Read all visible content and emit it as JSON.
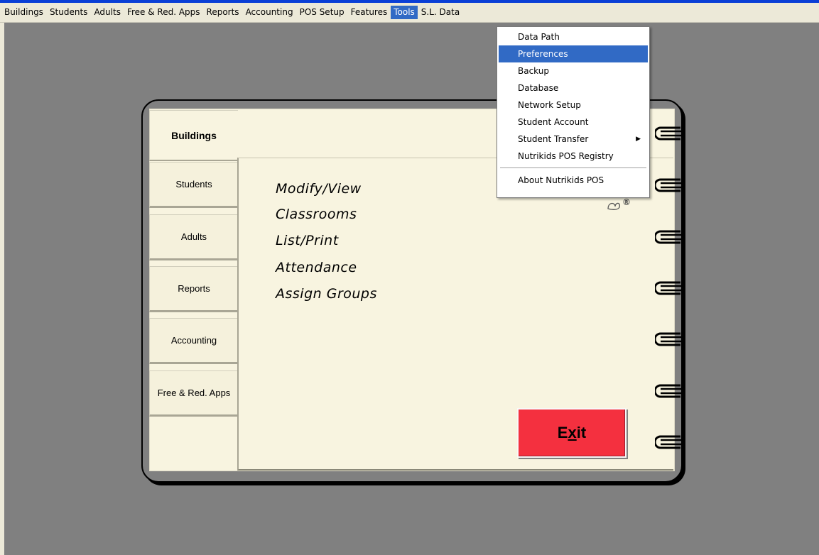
{
  "menubar": {
    "items": [
      {
        "label": "Buildings"
      },
      {
        "label": "Students"
      },
      {
        "label": "Adults"
      },
      {
        "label": "Free & Red. Apps"
      },
      {
        "label": "Reports"
      },
      {
        "label": "Accounting"
      },
      {
        "label": "POS Setup"
      },
      {
        "label": "Features"
      },
      {
        "label": "Tools"
      },
      {
        "label": "S.L. Data"
      }
    ],
    "active": "Tools"
  },
  "tools_menu": {
    "items": [
      {
        "label": "Data Path"
      },
      {
        "label": "Preferences"
      },
      {
        "label": "Backup"
      },
      {
        "label": "Database"
      },
      {
        "label": "Network Setup"
      },
      {
        "label": "Student Account"
      },
      {
        "label": "Student Transfer"
      },
      {
        "label": "Nutrikids POS Registry"
      },
      {
        "label": "About Nutrikids POS"
      }
    ],
    "highlighted": "Preferences"
  },
  "tabs": [
    {
      "label": "Buildings"
    },
    {
      "label": "Students"
    },
    {
      "label": "Adults"
    },
    {
      "label": "Reports"
    },
    {
      "label": "Accounting"
    },
    {
      "label": "Free & Red. Apps"
    }
  ],
  "selected_tab": "Buildings",
  "content_links": [
    {
      "label": "Modify/View"
    },
    {
      "label": "Classrooms"
    },
    {
      "label": "List/Print"
    },
    {
      "label": "Attendance"
    },
    {
      "label": "Assign Groups"
    }
  ],
  "logo_glyph": "®",
  "exit_button": {
    "pre": "E",
    "underlined": "x",
    "post": "it"
  },
  "colors": {
    "accent": "#316ac5",
    "exit": "#f4303f",
    "page": "#f8f4e0",
    "background": "#808080"
  }
}
